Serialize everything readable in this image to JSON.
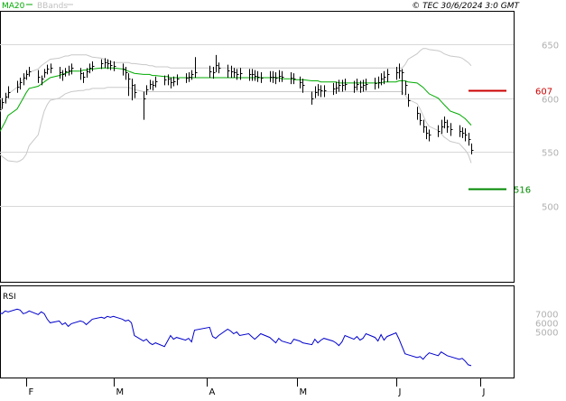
{
  "header": {
    "legend": [
      {
        "label": "MA20",
        "color": "#00aa00"
      },
      {
        "label": "BBands",
        "color": "#c0c0c0"
      }
    ],
    "copyright": "© TEC 30/6/2024 3:0 GMT"
  },
  "chart_data": [
    {
      "type": "ohlc",
      "title": "",
      "ylim": [
        430,
        680
      ],
      "y_ticks": [
        500,
        550,
        600,
        650
      ],
      "y_tick_labels": [
        "500",
        "550",
        "600",
        "650"
      ],
      "x_tick_labels": [
        "F",
        "M",
        "A",
        "M",
        "J",
        "J"
      ],
      "x_tick_dates": [
        "2024-02-01",
        "2024-03-01",
        "2024-04-01",
        "2024-05-01",
        "2024-06-03",
        "2024-07-01"
      ],
      "grid": true,
      "x": [
        "2024-01-22",
        "2024-01-23",
        "2024-01-24",
        "2024-01-25",
        "2024-01-26",
        "2024-01-29",
        "2024-01-30",
        "2024-01-31",
        "2024-02-01",
        "2024-02-02",
        "2024-02-05",
        "2024-02-06",
        "2024-02-07",
        "2024-02-08",
        "2024-02-09",
        "2024-02-12",
        "2024-02-13",
        "2024-02-14",
        "2024-02-15",
        "2024-02-16",
        "2024-02-19",
        "2024-02-20",
        "2024-02-21",
        "2024-02-22",
        "2024-02-23",
        "2024-02-26",
        "2024-02-27",
        "2024-02-28",
        "2024-02-29",
        "2024-03-01",
        "2024-03-04",
        "2024-03-05",
        "2024-03-06",
        "2024-03-07",
        "2024-03-08",
        "2024-03-11",
        "2024-03-12",
        "2024-03-13",
        "2024-03-14",
        "2024-03-15",
        "2024-03-18",
        "2024-03-19",
        "2024-03-20",
        "2024-03-21",
        "2024-03-22",
        "2024-03-25",
        "2024-03-26",
        "2024-03-27",
        "2024-03-28",
        "2024-04-02",
        "2024-04-03",
        "2024-04-04",
        "2024-04-05",
        "2024-04-08",
        "2024-04-09",
        "2024-04-10",
        "2024-04-11",
        "2024-04-12",
        "2024-04-15",
        "2024-04-16",
        "2024-04-17",
        "2024-04-18",
        "2024-04-19",
        "2024-04-22",
        "2024-04-23",
        "2024-04-24",
        "2024-04-25",
        "2024-04-26",
        "2024-04-29",
        "2024-04-30",
        "2024-05-02",
        "2024-05-03",
        "2024-05-06",
        "2024-05-07",
        "2024-05-08",
        "2024-05-09",
        "2024-05-10",
        "2024-05-13",
        "2024-05-14",
        "2024-05-15",
        "2024-05-16",
        "2024-05-17",
        "2024-05-20",
        "2024-05-21",
        "2024-05-22",
        "2024-05-23",
        "2024-05-24",
        "2024-05-27",
        "2024-05-28",
        "2024-05-29",
        "2024-05-30",
        "2024-05-31",
        "2024-06-03",
        "2024-06-04",
        "2024-06-05",
        "2024-06-06",
        "2024-06-07",
        "2024-06-10",
        "2024-06-11",
        "2024-06-12",
        "2024-06-13",
        "2024-06-14",
        "2024-06-17",
        "2024-06-18",
        "2024-06-19",
        "2024-06-20",
        "2024-06-21",
        "2024-06-24",
        "2024-06-25",
        "2024-06-26",
        "2024-06-27",
        "2024-06-28"
      ],
      "close": [
        584,
        590,
        596,
        601,
        606,
        611,
        615,
        619,
        622,
        625,
        620,
        618,
        624,
        627,
        628,
        624,
        622,
        625,
        626,
        628,
        623,
        620,
        625,
        628,
        630,
        632,
        633,
        632,
        631,
        630,
        627,
        624,
        618,
        612,
        606,
        600,
        608,
        613,
        612,
        616,
        617,
        618,
        615,
        616,
        618,
        619,
        620,
        622,
        624,
        625,
        624,
        631,
        628,
        626,
        625,
        624,
        622,
        623,
        622,
        622,
        621,
        620,
        619,
        620,
        620,
        619,
        621,
        620,
        619,
        618,
        615,
        612,
        600,
        606,
        608,
        607,
        607,
        609,
        610,
        612,
        612,
        613,
        611,
        613,
        611,
        612,
        613,
        614,
        615,
        618,
        620,
        622,
        624,
        626,
        624,
        612,
        598,
        586,
        580,
        574,
        568,
        566,
        570,
        574,
        578,
        574,
        571,
        570,
        568,
        566,
        562,
        552
      ],
      "high": [
        590,
        596,
        600,
        605,
        611,
        616,
        619,
        623,
        626,
        629,
        626,
        621,
        627,
        631,
        632,
        629,
        626,
        628,
        630,
        632,
        628,
        624,
        628,
        632,
        634,
        636,
        637,
        636,
        635,
        634,
        632,
        629,
        623,
        618,
        613,
        606,
        612,
        617,
        616,
        620,
        621,
        622,
        619,
        620,
        622,
        623,
        624,
        626,
        638,
        630,
        629,
        640,
        633,
        631,
        630,
        628,
        627,
        628,
        627,
        627,
        626,
        625,
        624,
        625,
        625,
        624,
        626,
        625,
        624,
        623,
        620,
        618,
        606,
        611,
        613,
        612,
        612,
        614,
        615,
        617,
        617,
        618,
        616,
        618,
        616,
        617,
        618,
        619,
        620,
        623,
        625,
        627,
        629,
        632,
        627,
        616,
        604,
        592,
        586,
        580,
        574,
        571,
        575,
        580,
        583,
        580,
        577,
        575,
        573,
        572,
        568,
        558
      ],
      "low": [
        578,
        584,
        590,
        595,
        600,
        605,
        608,
        612,
        617,
        620,
        614,
        612,
        619,
        622,
        623,
        618,
        616,
        620,
        621,
        622,
        617,
        614,
        619,
        623,
        625,
        627,
        628,
        627,
        626,
        625,
        621,
        617,
        602,
        598,
        600,
        580,
        603,
        608,
        607,
        610,
        612,
        612,
        609,
        611,
        612,
        614,
        615,
        617,
        619,
        619,
        618,
        624,
        623,
        619,
        619,
        619,
        617,
        617,
        616,
        616,
        616,
        615,
        614,
        615,
        614,
        613,
        615,
        615,
        613,
        613,
        609,
        605,
        594,
        600,
        602,
        601,
        601,
        603,
        604,
        606,
        606,
        607,
        605,
        607,
        605,
        606,
        607,
        608,
        609,
        612,
        613,
        615,
        617,
        618,
        603,
        603,
        592,
        580,
        575,
        568,
        562,
        560,
        564,
        567,
        572,
        568,
        565,
        564,
        563,
        560,
        556,
        548
      ],
      "ma20": [
        562,
        568,
        573,
        578,
        584,
        590,
        595,
        600,
        605,
        609,
        611,
        613,
        615,
        617,
        619,
        621,
        622,
        623,
        624,
        625,
        625,
        626,
        626,
        627,
        627,
        628,
        628,
        628,
        628,
        628,
        627,
        626,
        625,
        624,
        623,
        622,
        622,
        622,
        621,
        621,
        620,
        620,
        619,
        619,
        619,
        619,
        619,
        619,
        619,
        619,
        619,
        619,
        619,
        619,
        619,
        619,
        619,
        619,
        619,
        619,
        619,
        619,
        619,
        619,
        619,
        619,
        619,
        618,
        618,
        617,
        617,
        617,
        616,
        616,
        616,
        615,
        615,
        615,
        615,
        614,
        614,
        614,
        614,
        614,
        614,
        614,
        614,
        614,
        614,
        614,
        615,
        615,
        615,
        616,
        616,
        616,
        615,
        614,
        612,
        610,
        607,
        604,
        600,
        597,
        594,
        591,
        588,
        585,
        583,
        581,
        578,
        575
      ],
      "bb_upper": [
        580,
        586,
        592,
        598,
        604,
        610,
        614,
        618,
        621,
        624,
        627,
        630,
        632,
        634,
        636,
        637,
        638,
        639,
        639,
        640,
        640,
        640,
        640,
        639,
        638,
        637,
        636,
        635,
        634,
        633,
        633,
        633,
        633,
        632,
        632,
        631,
        631,
        630,
        630,
        629,
        629,
        629,
        628,
        628,
        628,
        628,
        628,
        628,
        628,
        628,
        628,
        628,
        628,
        628,
        628,
        628,
        628,
        628,
        628,
        628,
        628,
        628,
        628,
        628,
        628,
        628,
        628,
        628,
        628,
        628,
        628,
        628,
        628,
        628,
        628,
        628,
        628,
        628,
        628,
        628,
        628,
        628,
        628,
        628,
        628,
        628,
        628,
        628,
        628,
        628,
        628,
        628,
        628,
        628,
        628,
        631,
        636,
        641,
        644,
        646,
        646,
        645,
        644,
        643,
        641,
        640,
        639,
        638,
        637,
        635,
        633,
        630
      ],
      "bb_lower": [
        552,
        549,
        546,
        544,
        542,
        541,
        542,
        544,
        548,
        556,
        566,
        578,
        588,
        594,
        598,
        600,
        602,
        604,
        605,
        606,
        607,
        607,
        608,
        608,
        609,
        609,
        609,
        610,
        610,
        610,
        610,
        610,
        610,
        609,
        608,
        606,
        606,
        606,
        606,
        606,
        606,
        606,
        606,
        606,
        606,
        606,
        606,
        606,
        606,
        606,
        606,
        606,
        606,
        606,
        606,
        606,
        606,
        606,
        606,
        606,
        606,
        606,
        606,
        606,
        606,
        606,
        606,
        606,
        606,
        606,
        606,
        606,
        606,
        606,
        606,
        606,
        606,
        606,
        606,
        606,
        606,
        606,
        606,
        606,
        606,
        606,
        606,
        606,
        606,
        606,
        606,
        606,
        606,
        606,
        606,
        603,
        599,
        595,
        590,
        584,
        578,
        574,
        570,
        567,
        564,
        562,
        560,
        558,
        555,
        552,
        548,
        540
      ],
      "levels": [
        {
          "label": "607",
          "value": 607,
          "color": "#cc0000"
        },
        {
          "label": "516",
          "value": 516,
          "color": "#008800"
        }
      ]
    },
    {
      "type": "line",
      "title": "RSI",
      "ylim": [
        0,
        100
      ],
      "y_ticks": [
        70,
        60,
        50
      ],
      "y_tick_labels": [
        "7000",
        "6000",
        "5000"
      ],
      "series": [
        {
          "name": "RSI",
          "color": "#0000cc",
          "values": [
            68,
            71,
            70,
            73,
            72,
            75,
            74,
            70,
            71,
            73,
            69,
            72,
            70,
            64,
            60,
            62,
            58,
            60,
            56,
            59,
            62,
            61,
            58,
            61,
            64,
            66,
            65,
            67,
            66,
            67,
            64,
            62,
            63,
            60,
            46,
            40,
            42,
            38,
            36,
            38,
            34,
            40,
            46,
            42,
            44,
            41,
            43,
            39,
            52,
            55,
            45,
            43,
            46,
            53,
            51,
            48,
            50,
            46,
            48,
            45,
            42,
            45,
            48,
            44,
            41,
            38,
            43,
            40,
            37,
            42,
            40,
            38,
            36,
            42,
            38,
            41,
            43,
            40,
            38,
            35,
            39,
            46,
            42,
            45,
            41,
            43,
            48,
            44,
            40,
            47,
            41,
            45,
            49,
            42,
            34,
            26,
            25,
            22,
            23,
            20,
            24,
            27,
            24,
            28,
            26,
            24,
            23,
            20,
            21,
            18,
            14,
            13
          ]
        }
      ]
    }
  ]
}
